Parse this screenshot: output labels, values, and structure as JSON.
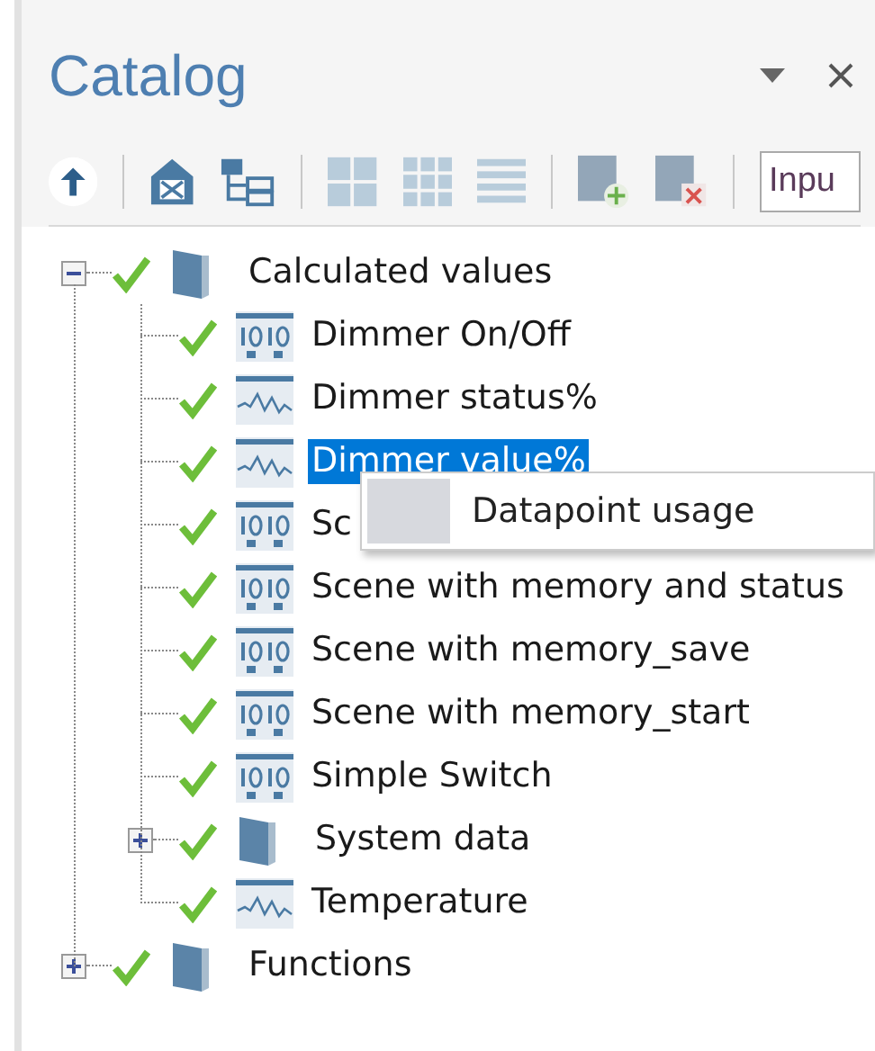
{
  "panel": {
    "title": "Catalog"
  },
  "toolbar": {
    "search_field": {
      "value": "Inpu"
    }
  },
  "tree": [
    {
      "label": "Calculated values",
      "kind": "folder",
      "valid": true,
      "expanded": true,
      "selected": false,
      "children": [
        {
          "label": "Dimmer On/Off",
          "kind": "binary",
          "valid": true,
          "selected": false
        },
        {
          "label": "Dimmer status%",
          "kind": "analog",
          "valid": true,
          "selected": false
        },
        {
          "label": "Dimmer value%",
          "kind": "analog",
          "valid": true,
          "selected": true
        },
        {
          "label": "Sc",
          "kind": "binary",
          "valid": true,
          "selected": false
        },
        {
          "label": "Scene with memory and status",
          "kind": "binary",
          "valid": true,
          "selected": false
        },
        {
          "label": "Scene with memory_save",
          "kind": "binary",
          "valid": true,
          "selected": false
        },
        {
          "label": "Scene with memory_start",
          "kind": "binary",
          "valid": true,
          "selected": false
        },
        {
          "label": "Simple Switch",
          "kind": "binary",
          "valid": true,
          "selected": false
        },
        {
          "label": "System data",
          "kind": "folder",
          "valid": true,
          "expanded": false,
          "selected": false
        },
        {
          "label": "Temperature",
          "kind": "analog",
          "valid": true,
          "selected": false
        }
      ]
    },
    {
      "label": "Functions",
      "kind": "folder",
      "valid": true,
      "expanded": false,
      "selected": false
    }
  ],
  "context_menu": {
    "items": [
      {
        "label": "Datapoint usage"
      }
    ]
  }
}
